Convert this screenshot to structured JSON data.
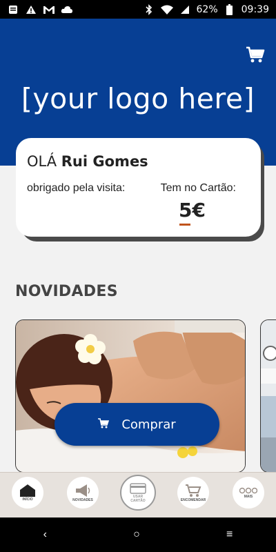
{
  "status_bar": {
    "battery": "62%",
    "time": "09:39"
  },
  "header": {
    "logo_text": "[your logo here]",
    "cart_icon": "cart-icon",
    "brand_color": "#073f94"
  },
  "welcome_card": {
    "greeting_prefix": "OLÁ",
    "user_name": "Rui Gomes",
    "thanks_text": "obrigado pela visita:",
    "card_label": "Tem no Cartão:",
    "balance": "5€",
    "accent_color": "#c0531c"
  },
  "novidades": {
    "title": "NOVIDADES",
    "promo": {
      "image": "spa-massage-photo",
      "buy_label": "Comprar"
    }
  },
  "bottom_nav": {
    "items": [
      {
        "label": "INÍCIO",
        "icon": "home-icon"
      },
      {
        "label": "NOVIDADES",
        "icon": "megaphone-icon"
      },
      {
        "label": "USAR\nCARTÃO",
        "icon": "card-icon"
      },
      {
        "label": "ENCOMENDAR",
        "icon": "cart-icon"
      },
      {
        "label": "MAIS",
        "icon": "more-icon"
      }
    ]
  },
  "android_nav": {
    "back": "‹",
    "home": "○",
    "menu": "≡"
  }
}
